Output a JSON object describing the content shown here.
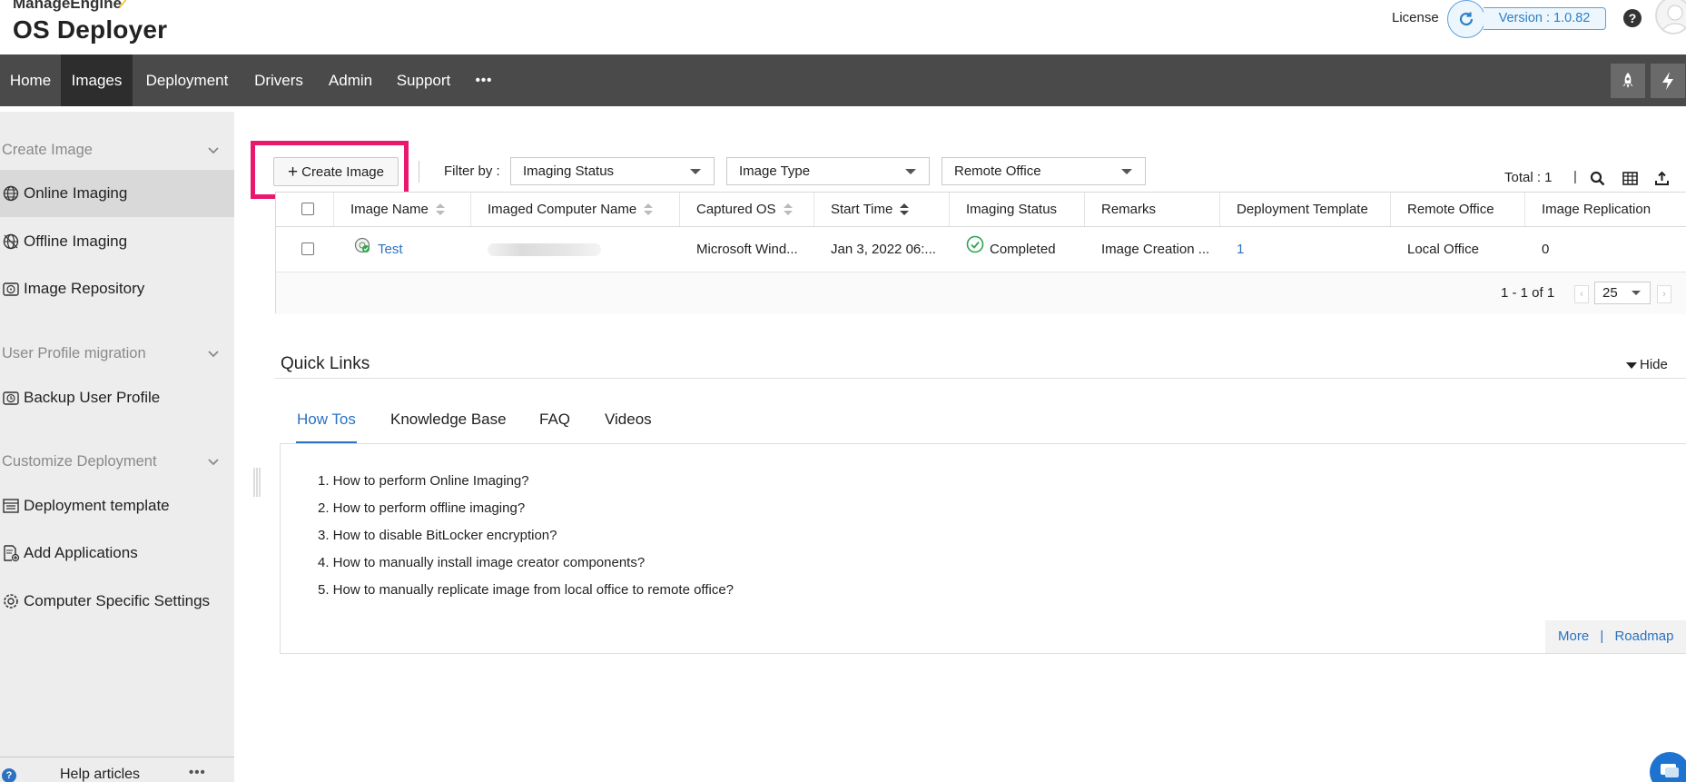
{
  "header": {
    "brand_top": "ManageEngine",
    "product": "OS Deployer",
    "license_label": "License",
    "version": "Version : 1.0.82",
    "help": "?"
  },
  "nav": {
    "items": [
      "Home",
      "Images",
      "Deployment",
      "Drivers",
      "Admin",
      "Support",
      "•••"
    ],
    "active": "Images"
  },
  "sidebar": {
    "sections": [
      {
        "title": "Create Image",
        "items": [
          "Online Imaging",
          "Offline Imaging",
          "Image Repository"
        ]
      },
      {
        "title": "User Profile migration",
        "items": [
          "Backup User Profile"
        ]
      },
      {
        "title": "Customize Deployment",
        "items": [
          "Deployment template",
          "Add Applications",
          "Computer Specific Settings"
        ]
      }
    ],
    "active_item": "Online Imaging",
    "footer_label": "Help articles"
  },
  "toolbar": {
    "create_label": "Create Image",
    "filter_label": "Filter by :",
    "filters": [
      "Imaging Status",
      "Image Type",
      "Remote Office"
    ],
    "total_label": "Total : 1",
    "pipe": "|"
  },
  "table": {
    "columns": [
      "Image Name",
      "Imaged Computer Name",
      "Captured OS",
      "Start Time",
      "Imaging Status",
      "Remarks",
      "Deployment Template",
      "Remote Office",
      "Image Replication"
    ],
    "rows": [
      {
        "image_name": "Test",
        "computer_name": "",
        "captured_os": "Microsoft Wind...",
        "start_time": "Jan 3, 2022 06:...",
        "status": "Completed",
        "remarks": "Image Creation ...",
        "template": "1",
        "remote_office": "Local Office",
        "replication": "0"
      }
    ],
    "pager": {
      "range": "1 - 1 of 1",
      "page_size": "25"
    }
  },
  "quick_links": {
    "title": "Quick Links",
    "hide_label": "Hide",
    "tabs": [
      "How Tos",
      "Knowledge Base",
      "FAQ",
      "Videos"
    ],
    "active_tab": "How Tos",
    "howtos": [
      "1. How to perform Online Imaging?",
      "2. How to perform offline imaging?",
      "3. How to disable BitLocker encryption?",
      "4. How to manually install image creator components?",
      "5. How to manually replicate image from local office to remote office?"
    ],
    "more": "More",
    "separator": "|",
    "roadmap": "Roadmap"
  },
  "colors": {
    "nav_bg": "#4a4a4a",
    "accent_link": "#2b72c2",
    "highlight": "#e8186d",
    "success": "#2ea44f"
  }
}
